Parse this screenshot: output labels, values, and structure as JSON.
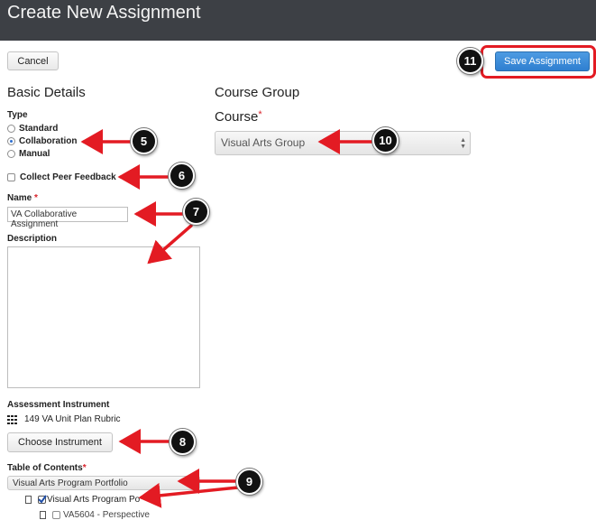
{
  "header": {
    "title": "Create New Assignment"
  },
  "toolbar": {
    "cancel_label": "Cancel",
    "save_label": "Save Assignment"
  },
  "basic": {
    "title": "Basic Details",
    "type_label": "Type",
    "types": [
      "Standard",
      "Collaboration",
      "Manual"
    ],
    "selected_type": "Collaboration",
    "peer_feedback_label": "Collect Peer Feedback",
    "peer_feedback_checked": false,
    "name_label": "Name",
    "required_mark": "*",
    "name_value": "VA Collaborative Assignment",
    "description_label": "Description",
    "description_value": "",
    "assessment_label": "Assessment Instrument",
    "assessment_value": "149 VA Unit Plan Rubric",
    "choose_instrument_label": "Choose Instrument",
    "toc_label": "Table of Contents",
    "toc_select_value": "Visual Arts Program Portfolio",
    "toc_tree": [
      {
        "label": "Visual Arts Program Po",
        "checked": true
      },
      {
        "label": "VA5604 - Perspective",
        "checked": false
      }
    ]
  },
  "course": {
    "group_title": "Course Group",
    "course_label": "Course",
    "required_mark": "*",
    "course_value": "Visual Arts Group"
  },
  "callouts": {
    "c5": "5",
    "c6": "6",
    "c7": "7",
    "c8": "8",
    "c9": "9",
    "c10": "10",
    "c11": "11"
  },
  "colors": {
    "accent": "#2f7fd0",
    "annotation": "#e31b23",
    "header": "#3d4045"
  },
  "icons": [
    "grid-icon",
    "document-icon",
    "checkbox-checked-icon",
    "radio-icon",
    "select-arrows-icon"
  ]
}
